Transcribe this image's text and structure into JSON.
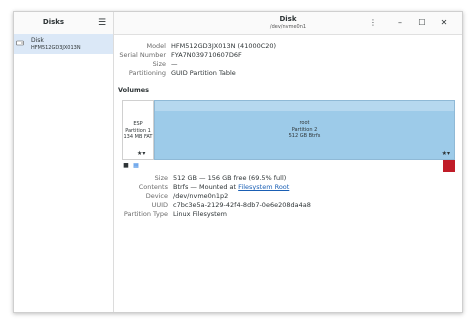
{
  "sidebar": {
    "title": "Disks",
    "disks": [
      {
        "name": "Disk",
        "model": "HFM512GD3JX013N"
      }
    ]
  },
  "header": {
    "title": "Disk",
    "subtitle": "/dev/nvme0n1"
  },
  "disk_info": [
    {
      "key": "Model",
      "value": "HFM512GD3JX013N (41000C20)"
    },
    {
      "key": "Serial Number",
      "value": "FYA7N039710607D6F"
    },
    {
      "key": "Size",
      "value": "—"
    },
    {
      "key": "Partitioning",
      "value": "GUID Partition Table"
    }
  ],
  "volumes_label": "Volumes",
  "partitions": {
    "esp": {
      "l1": "ESP",
      "l2": "Partition 1",
      "l3": "134 MB FAT"
    },
    "root": {
      "l1": "root",
      "l2": "Partition 2",
      "l3": "512 GB Btrfs"
    }
  },
  "volume_info": {
    "size_key": "Size",
    "size_value": "512 GB — 156 GB free (69.5% full)",
    "contents_key": "Contents",
    "contents_prefix": "Btrfs — Mounted at ",
    "contents_link": "Filesystem Root",
    "device_key": "Device",
    "device_value": "/dev/nvme0n1p2",
    "uuid_key": "UUID",
    "uuid_value": "c7bc3e5a-2129-42f4-8db7-0e6e208da4a8",
    "ptype_key": "Partition Type",
    "ptype_value": "Linux Filesystem"
  },
  "colors": {
    "accent": "#3584e4",
    "selection": "#dbe8f7",
    "root_partition": "#9dcbe9",
    "free_space": "#c01c28"
  },
  "icons": {
    "menu": "hamburger-icon",
    "kebab": "kebab-menu-icon",
    "minimize": "minimize-icon",
    "maximize": "maximize-icon",
    "close": "close-icon"
  }
}
